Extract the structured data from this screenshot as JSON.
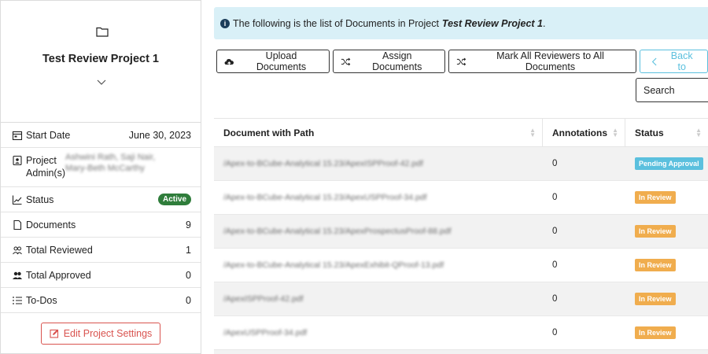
{
  "project": {
    "title": "Test Review Project 1"
  },
  "sidebar": {
    "start_date_label": "Start Date",
    "start_date_value": "June 30, 2023",
    "admin_label_1": "Project",
    "admin_label_2": "Admin(s)",
    "admin_names_1": "Ashwini Rath, Saji Nair,",
    "admin_names_2": "Mary-Beth McCarthy",
    "status_label": "Status",
    "status_value": "Active",
    "documents_label": "Documents",
    "documents_value": "9",
    "total_reviewed_label": "Total Reviewed",
    "total_reviewed_value": "1",
    "total_approved_label": "Total Approved",
    "total_approved_value": "0",
    "todos_label": "To-Dos",
    "todos_value": "0",
    "edit_button_label": "Edit Project Settings"
  },
  "alert": {
    "prefix": "The following is the list of Documents in Project",
    "project_name": "Test Review Project 1",
    "suffix": "."
  },
  "toolbar": {
    "upload_label": "Upload Documents",
    "assign_label": "Assign Documents",
    "mark_all_label": "Mark All Reviewers to All Documents",
    "back_label": "Back to"
  },
  "search": {
    "placeholder": "Search"
  },
  "table": {
    "headers": {
      "path": "Document with Path",
      "annotations": "Annotations",
      "status": "Status"
    },
    "rows": [
      {
        "path": "/Apex-to-BCube-Analytical 15.23/ApexISPProof-42.pdf",
        "annotations": "0",
        "status": "Pending Approval"
      },
      {
        "path": "/Apex-to-BCube-Analytical 15.23/ApexUSPProof-34.pdf",
        "annotations": "0",
        "status": "In Review"
      },
      {
        "path": "/Apex-to-BCube-Analytical 15.23/ApexProspectusProof-88.pdf",
        "annotations": "0",
        "status": "In Review"
      },
      {
        "path": "/Apex-to-BCube-Analytical 15.23/ApexExhibit-QProof-13.pdf",
        "annotations": "0",
        "status": "In Review"
      },
      {
        "path": "/ApexISPProof-42.pdf",
        "annotations": "0",
        "status": "In Review"
      },
      {
        "path": "/ApexUSPProof-34.pdf",
        "annotations": "0",
        "status": "In Review"
      }
    ]
  },
  "colors": {
    "pending_approval": "#5bc0de",
    "in_review": "#f0ad4e",
    "active": "#2f7d3b",
    "danger": "#d9534f",
    "info_bg": "#d9f0f7"
  }
}
